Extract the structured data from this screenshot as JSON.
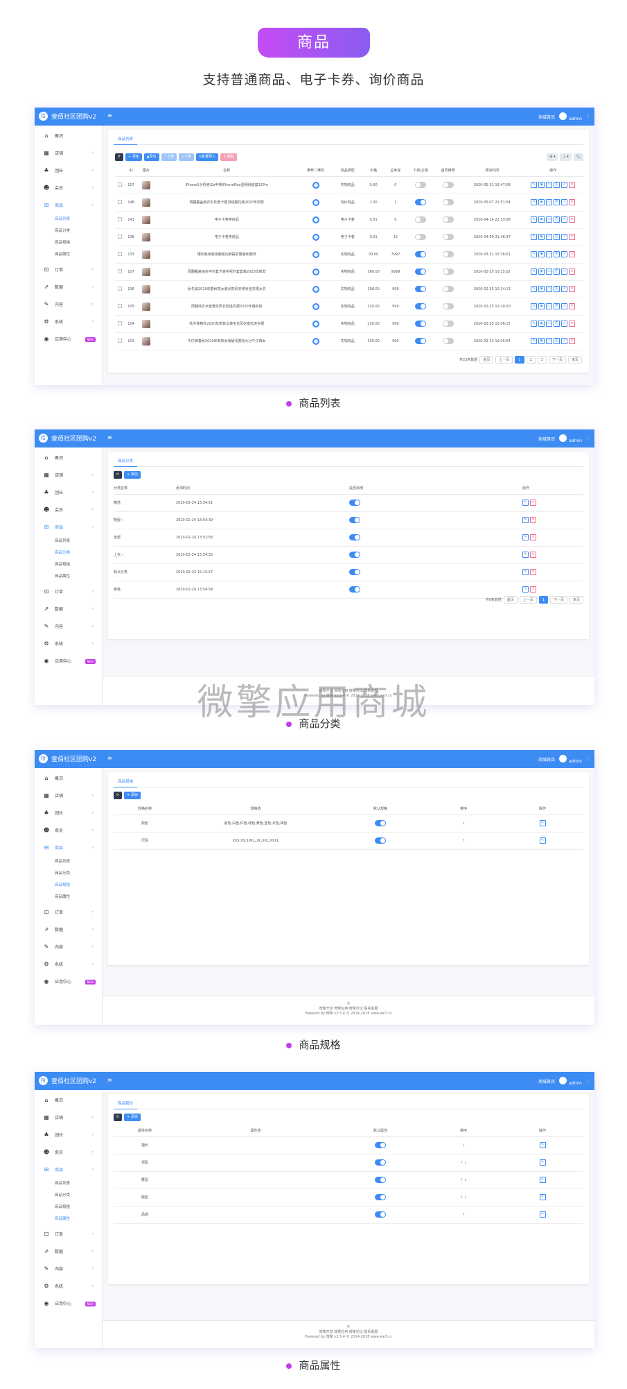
{
  "header": {
    "badge": "商品",
    "subtitle": "支持普通商品、电子卡券、询价商品"
  },
  "app": {
    "logo_text": "壹佰社区团购v2",
    "logo_icon": "拾",
    "menu_icon": "≡",
    "home_link": "商城首页",
    "admin": "admin",
    "more": "⋮"
  },
  "sidebar": {
    "items": [
      {
        "icon": "⌂",
        "label": "概况"
      },
      {
        "icon": "▦",
        "label": "店铺",
        "arrow": "›"
      },
      {
        "icon": "♣",
        "label": "团长",
        "arrow": "›"
      },
      {
        "icon": "☻",
        "label": "会员",
        "arrow": "›"
      },
      {
        "icon": "⊞",
        "label": "商品",
        "arrow": "›"
      },
      {
        "icon": "⊡",
        "label": "订单",
        "arrow": "›"
      },
      {
        "icon": "⇗",
        "label": "数据",
        "arrow": "›"
      },
      {
        "icon": "✎",
        "label": "内容",
        "arrow": "›"
      },
      {
        "icon": "⚙",
        "label": "系统",
        "arrow": "›"
      },
      {
        "icon": "◉",
        "label": "应用中心",
        "badge": "NEW"
      }
    ],
    "subs": [
      "商品列表",
      "商品分类",
      "商品规格",
      "商品属性"
    ]
  },
  "s1": {
    "tab": "商品列表",
    "caption": "商品列表",
    "buttons": [
      "⟳",
      "+ 添加",
      "▲导出",
      "⇡上架",
      "⇣下架",
      "⊡批量导入",
      "✕ 删除"
    ],
    "tools": [
      "⊞ ▾",
      "⇩ ▾",
      "🔍"
    ],
    "columns": [
      "",
      "ID",
      "图片",
      "名称",
      "推荐二维码",
      "商品类型",
      "价格",
      "总库存",
      "下架/正常",
      "首页推荐",
      "添加时间",
      "操作"
    ],
    "rows": [
      {
        "id": "107",
        "name": "iPhone1手机壳/2a苹果iPhoneMax透明硅胶套12Pro",
        "type": "实物商品",
        "price": "0.00",
        "stock": "0",
        "onsale": false,
        "rec": false,
        "time": "2020-05-31 16:47:08"
      },
      {
        "id": "148",
        "name": "周翻覆盖雨衣中外套卡套羽绒服花装2020年新款",
        "type": "询价商品",
        "price": "1.00",
        "stock": "1",
        "onsale": true,
        "rec": false,
        "time": "2020-05-07 21:51:04"
      },
      {
        "id": "141",
        "name": "电子卡卷类商品",
        "type": "电子卡卷",
        "price": "0.01",
        "stock": "0",
        "onsale": false,
        "rec": false,
        "time": "2020-04-14 22:53:08"
      },
      {
        "id": "136",
        "name": "电子卡卷类商品",
        "type": "电子卡卷",
        "price": "0.01",
        "stock": "15",
        "onsale": false,
        "rec": false,
        "time": "2020-04-09 21:46:37"
      },
      {
        "id": "133",
        "name": "懂你最亲最亲服装内裤摆衣服装和服饰",
        "type": "实物商品",
        "price": "30.00",
        "stock": "7997",
        "onsale": true,
        "rec": false,
        "time": "2020-03-31 15:36:01"
      },
      {
        "id": "107",
        "name": "周翻覆盖雨衣中外套卡装毛呢外套套装2020年新款",
        "type": "实物商品",
        "price": "360.00",
        "stock": "9999",
        "onsale": true,
        "rec": false,
        "time": "2020-02-25 10:15:02"
      },
      {
        "id": "106",
        "name": "秋冬装2020年春秋款女装长款风衣修身连衣裙大衣",
        "type": "实物商品",
        "price": "198.00",
        "stock": "999",
        "onsale": true,
        "rec": false,
        "time": "2020-02-25 10:14:13"
      },
      {
        "id": "105",
        "name": "周翻线衣女装宽松风长款连衣裙2020年春秋款",
        "type": "实物商品",
        "price": "220.00",
        "stock": "999",
        "onsale": true,
        "rec": false,
        "time": "2020-02-25 10:20:20"
      },
      {
        "id": "104",
        "name": "秋冬装春秋2020年新款女装毛衣风衣宽松连衣裙",
        "type": "实物商品",
        "price": "230.00",
        "stock": "999",
        "onsale": true,
        "rec": false,
        "time": "2020-02-25 10:06:15"
      },
      {
        "id": "103",
        "name": "牛仔裤春秋2020年新款女装破洞宽松九分牛仔裤女",
        "type": "实物商品",
        "price": "330.00",
        "stock": "999",
        "onsale": true,
        "rec": false,
        "time": "2020-02-25 10:05:54"
      }
    ],
    "pager": {
      "total": "共23条数据",
      "first": "首页",
      "prev": "上一页",
      "pages": [
        "1",
        "2",
        "3"
      ],
      "next": "下一页",
      "last": "末页"
    }
  },
  "s2": {
    "tab": "商品分类",
    "caption": "商品分类",
    "add": "+ 添加",
    "columns": [
      "分类名称",
      "添加时间",
      "是否启用",
      "操作"
    ],
    "rows": [
      {
        "name": "精选",
        "time": "2020-02-24 13:54:51"
      },
      {
        "name": "鞋服 ›",
        "time": "2020-02-24 13:54:39"
      },
      {
        "name": "全部",
        "time": "2020-02-24 13:52:58"
      },
      {
        "name": "上衣 ›",
        "time": "2020-02-24 13:54:33"
      },
      {
        "name": "默认分类",
        "time": "2020-02-23 15:12:57"
      },
      {
        "name": "裤装",
        "time": "2020-02-24 13:54:58"
      }
    ],
    "pager": {
      "total": "共6条数据",
      "first": "首页",
      "prev": "上一页",
      "pages": [
        "1"
      ],
      "next": "下一页",
      "last": "末页"
    },
    "footer": [
      "微擎开发 微擎应用 微擎论坛 联系客服",
      "Powered by 微擎 v2.5.4 © 2014-2018 www.we7.cc"
    ],
    "watermark": "微擎应用商城"
  },
  "s3": {
    "tab": "商品规格",
    "caption": "商品规格",
    "add": "+ 添加",
    "columns": [
      "规格名称",
      "规格值",
      "默认规格",
      "排序",
      "操作"
    ],
    "rows": [
      {
        "name": "颜色",
        "value": "黑色,白色,红色,绿色,黄色,蓝色,灰色,褐色",
        "sort": "↓"
      },
      {
        "name": "尺码",
        "value": "XXS,XS,S,M,L,XL,XXL,XXXL",
        "sort": "↑"
      }
    ],
    "footer": [
      "©",
      "微擎开发 微擎应用 微擎论坛 联系客服",
      "Powered by 微擎 v2.5.4 © 2014-2018 www.we7.cc"
    ]
  },
  "s4": {
    "tab": "商品属性",
    "caption": "商品属性",
    "add": "+ 添加",
    "columns": [
      "属性名称",
      "属性值",
      "默认属性",
      "排序",
      "操作"
    ],
    "rows": [
      {
        "name": "袖长",
        "sort": "↓"
      },
      {
        "name": "领型",
        "sort": "↑ ↓"
      },
      {
        "name": "腰型",
        "sort": "↑ ↓"
      },
      {
        "name": "版型",
        "sort": "↑ ↓"
      },
      {
        "name": "品牌",
        "sort": "↑"
      }
    ],
    "footer": [
      "©",
      "微擎开发 微擎应用 微擎论坛 联系客服",
      "Powered by 微擎 v2.5.4 © 2014-2018 www.we7.cc"
    ]
  }
}
